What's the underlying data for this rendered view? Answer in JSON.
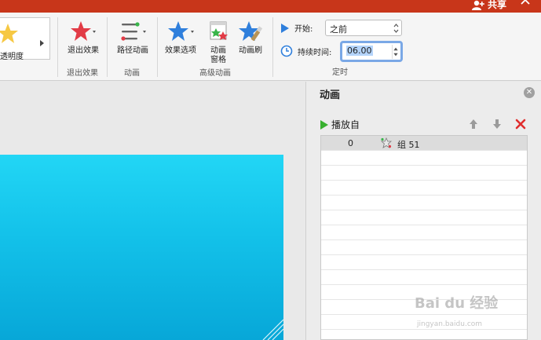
{
  "titlebar": {
    "share_label": "共享"
  },
  "ribbon": {
    "gallery_label": "透明度",
    "exit_effect_label": "退出效果",
    "path_animation_label": "路径动画",
    "effect_options_label": "效果选项",
    "animation_pane_label_1": "动画",
    "animation_pane_label_2": "窗格",
    "animation_painter_label": "动画刷",
    "groups": {
      "exit": "退出效果",
      "animation": "动画",
      "advanced": "高级动画",
      "timing": "定时"
    },
    "timing": {
      "start_label": "开始:",
      "start_value": "之前",
      "duration_label": "持续时间:",
      "duration_value": "06.00"
    }
  },
  "pane": {
    "title": "动画",
    "play_from_label": "播放自",
    "items": [
      {
        "index": "0",
        "name": "组 51"
      }
    ]
  },
  "watermark": {
    "brand": "Bai du 经验",
    "url": "jingyan.baidu.com"
  },
  "colors": {
    "titlebar": "#c8361a",
    "exit_star": "#e23b46",
    "blue_star": "#2f7fdc",
    "play_green": "#38b02f",
    "delete_red": "#e02d2d"
  }
}
